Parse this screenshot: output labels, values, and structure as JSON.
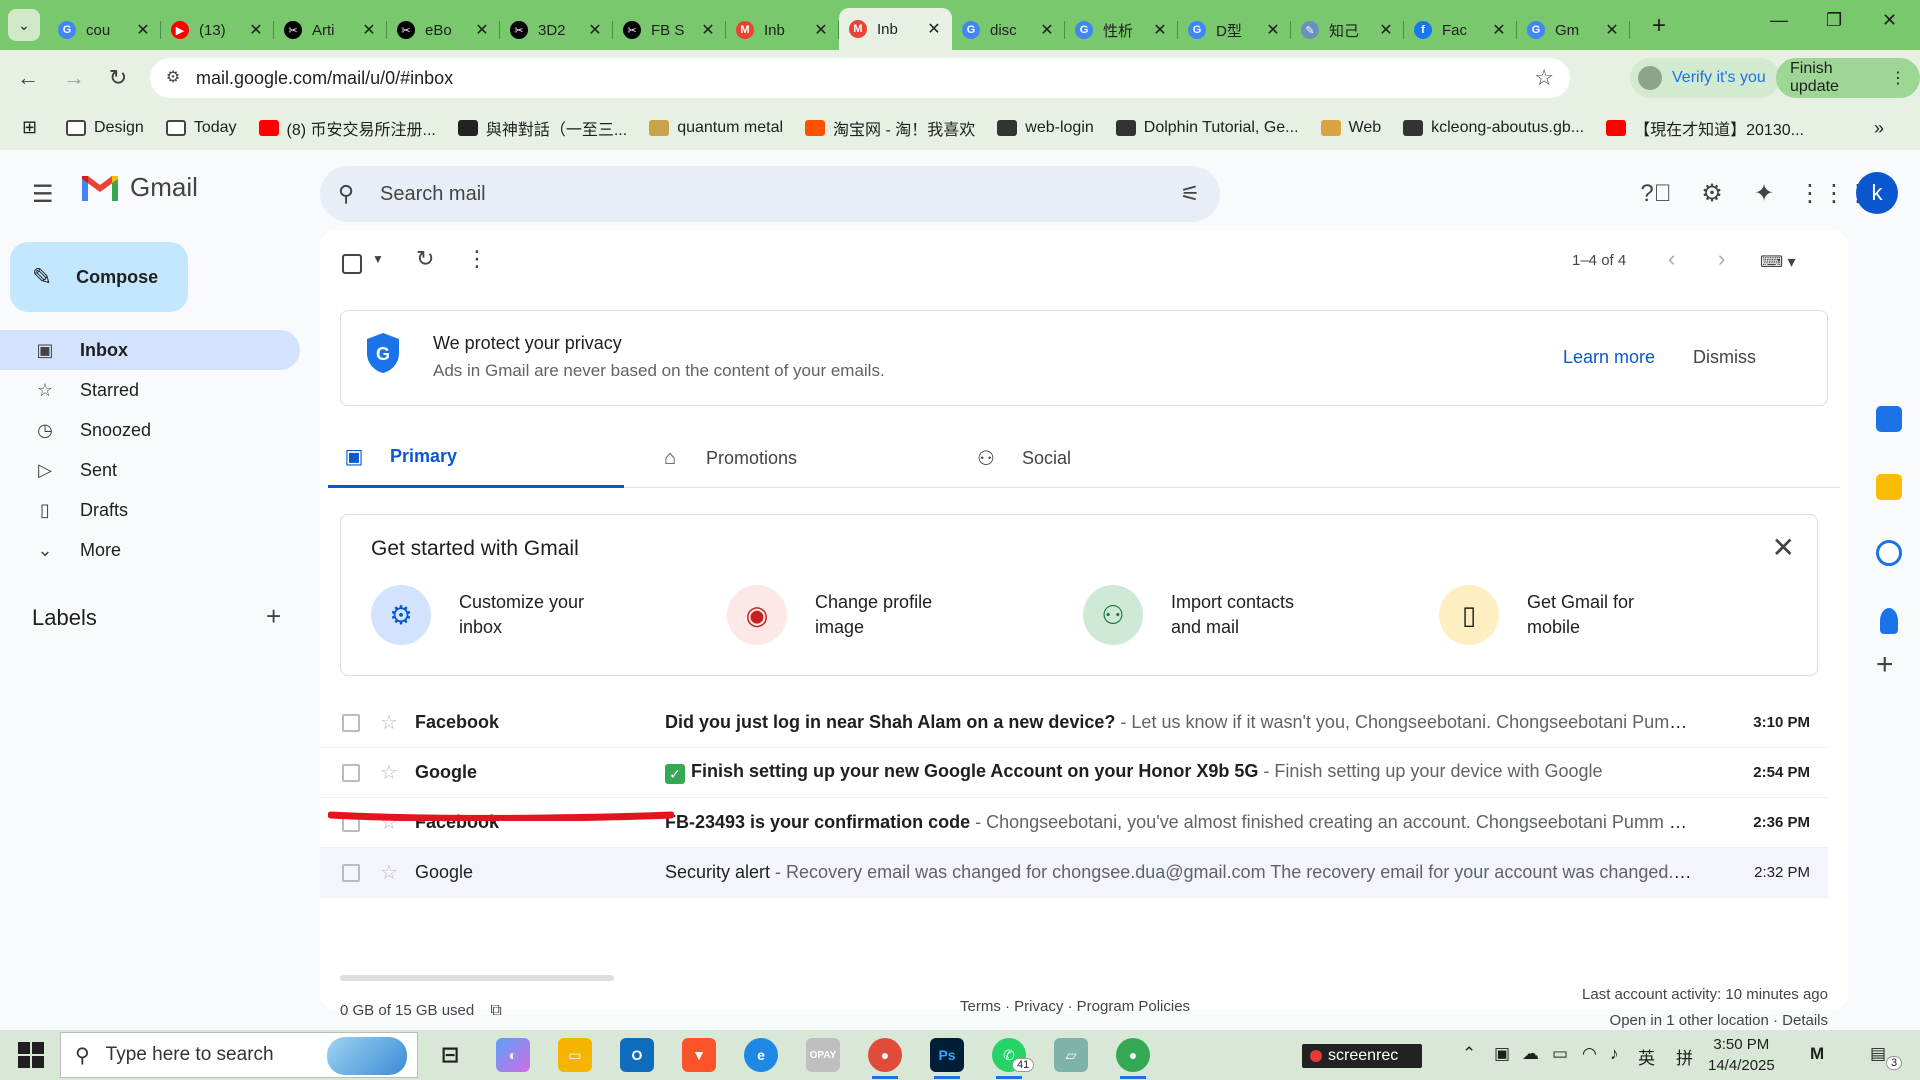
{
  "browser": {
    "tabs": [
      {
        "title": "cou",
        "icon": "google-icon",
        "color": "#4285f4",
        "glyph": "G"
      },
      {
        "title": "(13)",
        "icon": "youtube-icon",
        "color": "#ff0000",
        "glyph": "▶"
      },
      {
        "title": "Arti",
        "icon": "capcut-icon",
        "color": "#000000",
        "glyph": "✂"
      },
      {
        "title": "eBo",
        "icon": "capcut-icon",
        "color": "#000000",
        "glyph": "✂"
      },
      {
        "title": "3D2",
        "icon": "capcut-icon",
        "color": "#000000",
        "glyph": "✂"
      },
      {
        "title": "FB S",
        "icon": "capcut-icon",
        "color": "#000000",
        "glyph": "✂"
      },
      {
        "title": "Inb",
        "icon": "gmail-icon",
        "color": "#ea4335",
        "glyph": "M"
      },
      {
        "title": "Inb",
        "icon": "gmail-icon",
        "color": "#ea4335",
        "glyph": "M"
      },
      {
        "title": "disc",
        "icon": "google-icon",
        "color": "#4285f4",
        "glyph": "G"
      },
      {
        "title": "性析",
        "icon": "google-icon",
        "color": "#4285f4",
        "glyph": "G"
      },
      {
        "title": "D型",
        "icon": "google-icon",
        "color": "#4285f4",
        "glyph": "G"
      },
      {
        "title": "知己",
        "icon": "search-tool-icon",
        "color": "#6b8fbf",
        "glyph": "✎"
      },
      {
        "title": "Fac",
        "icon": "facebook-icon",
        "color": "#1877f2",
        "glyph": "f"
      },
      {
        "title": "Gm",
        "icon": "google-icon",
        "color": "#4285f4",
        "glyph": "G"
      }
    ],
    "active_tab_index": 7,
    "url": "mail.google.com/mail/u/0/#inbox",
    "verify_label": "Verify it's you",
    "finish_update_label": "Finish update",
    "bookmarks": [
      {
        "label": "Design",
        "icon": "folder-icon",
        "color": "#ffffff"
      },
      {
        "label": "Today",
        "icon": "folder-icon",
        "color": "#ffffff"
      },
      {
        "label": "(8) 币安交易所注册...",
        "icon": "youtube-icon",
        "color": "#ff0000"
      },
      {
        "label": "與神對話（一至三...",
        "icon": "book-icon",
        "color": "#222222"
      },
      {
        "label": "quantum metal",
        "icon": "metal-icon",
        "color": "#c9a34a"
      },
      {
        "label": "淘宝网 - 淘！我喜欢",
        "icon": "taobao-icon",
        "color": "#ff5000"
      },
      {
        "label": "web-login",
        "icon": "globe-icon",
        "color": "#333333"
      },
      {
        "label": "Dolphin Tutorial, Ge...",
        "icon": "dolphin-icon",
        "color": "#333333"
      },
      {
        "label": "Web",
        "icon": "web-icon",
        "color": "#d9a441"
      },
      {
        "label": "kcleong-aboutus.gb...",
        "icon": "globe-icon",
        "color": "#333333"
      },
      {
        "label": "【現在才知道】20130...",
        "icon": "youtube-icon",
        "color": "#ff0000"
      }
    ]
  },
  "gmail": {
    "app_name": "Gmail",
    "search_placeholder": "Search mail",
    "avatar_letter": "k",
    "compose_label": "Compose",
    "nav": [
      {
        "label": "Inbox",
        "icon": "inbox-icon",
        "glyph": "▣",
        "active": true
      },
      {
        "label": "Starred",
        "icon": "star-icon",
        "glyph": "☆",
        "active": false
      },
      {
        "label": "Snoozed",
        "icon": "clock-icon",
        "glyph": "◷",
        "active": false
      },
      {
        "label": "Sent",
        "icon": "send-icon",
        "glyph": "▷",
        "active": false
      },
      {
        "label": "Drafts",
        "icon": "draft-icon",
        "glyph": "▯",
        "active": false
      },
      {
        "label": "More",
        "icon": "chevron-down-icon",
        "glyph": "⌄",
        "active": false
      }
    ],
    "labels_heading": "Labels",
    "pager_text": "1–4 of 4",
    "privacy": {
      "title": "We protect your privacy",
      "subtitle": "Ads in Gmail are never based on the content of your emails.",
      "learn_more": "Learn more",
      "dismiss": "Dismiss"
    },
    "tabs": [
      {
        "label": "Primary",
        "icon": "inbox-icon",
        "active": true
      },
      {
        "label": "Promotions",
        "icon": "tag-icon",
        "active": false
      },
      {
        "label": "Social",
        "icon": "people-icon",
        "active": false
      }
    ],
    "get_started": {
      "title": "Get started with Gmail",
      "cards": [
        {
          "label": "Customize your inbox",
          "icon": "gear-icon",
          "bg": "#d3e3fd",
          "fg": "#0b57d0"
        },
        {
          "label": "Change profile image",
          "icon": "profile-icon",
          "bg": "#fce8e6",
          "fg": "#c5221f"
        },
        {
          "label": "Import contacts and mail",
          "icon": "add-person-icon",
          "bg": "#ceead6",
          "fg": "#137333"
        },
        {
          "label": "Get Gmail for mobile",
          "icon": "phone-icon",
          "bg": "#feefc3",
          "fg": "#1f1f1f"
        }
      ]
    },
    "emails": [
      {
        "from": "Facebook",
        "subject": "Did you just log in near Shah Alam on a new device?",
        "snippet": " - Let us know if it wasn't you, Chongseebotani. Chongseebotani Pumm ...",
        "time": "3:10 PM",
        "unread": true,
        "has_check": false
      },
      {
        "from": "Google",
        "subject": "Finish setting up your new Google Account on your Honor X9b 5G",
        "snippet": " - Finish setting up your device with Google",
        "time": "2:54 PM",
        "unread": true,
        "has_check": true
      },
      {
        "from": "Facebook",
        "subject": "FB-23493 is your confirmation code",
        "snippet": " - Chongseebotani, you've almost finished creating an account. Chongseebotani Pumm O...",
        "time": "2:36 PM",
        "unread": true,
        "has_check": false
      },
      {
        "from": "Google",
        "subject": "Security alert",
        "snippet": " - Recovery email was changed for chongsee.dua@gmail.com The recovery email for your account was changed. If...",
        "time": "2:32 PM",
        "unread": false,
        "has_check": false
      }
    ],
    "footer": {
      "storage": "0 GB of 15 GB used",
      "links": "Terms · Privacy · Program Policies",
      "activity_line1": "Last account activity: 10 minutes ago",
      "activity_line2": "Open in 1 other location · Details"
    }
  },
  "taskbar": {
    "search_placeholder": "Type here to search",
    "screenrec_label": "screenrec",
    "whatsapp_badge": "41",
    "notification_badge": "3",
    "ime_label": "英",
    "ime2_label": "拼",
    "time": "3:50 PM",
    "date": "14/4/2025"
  }
}
